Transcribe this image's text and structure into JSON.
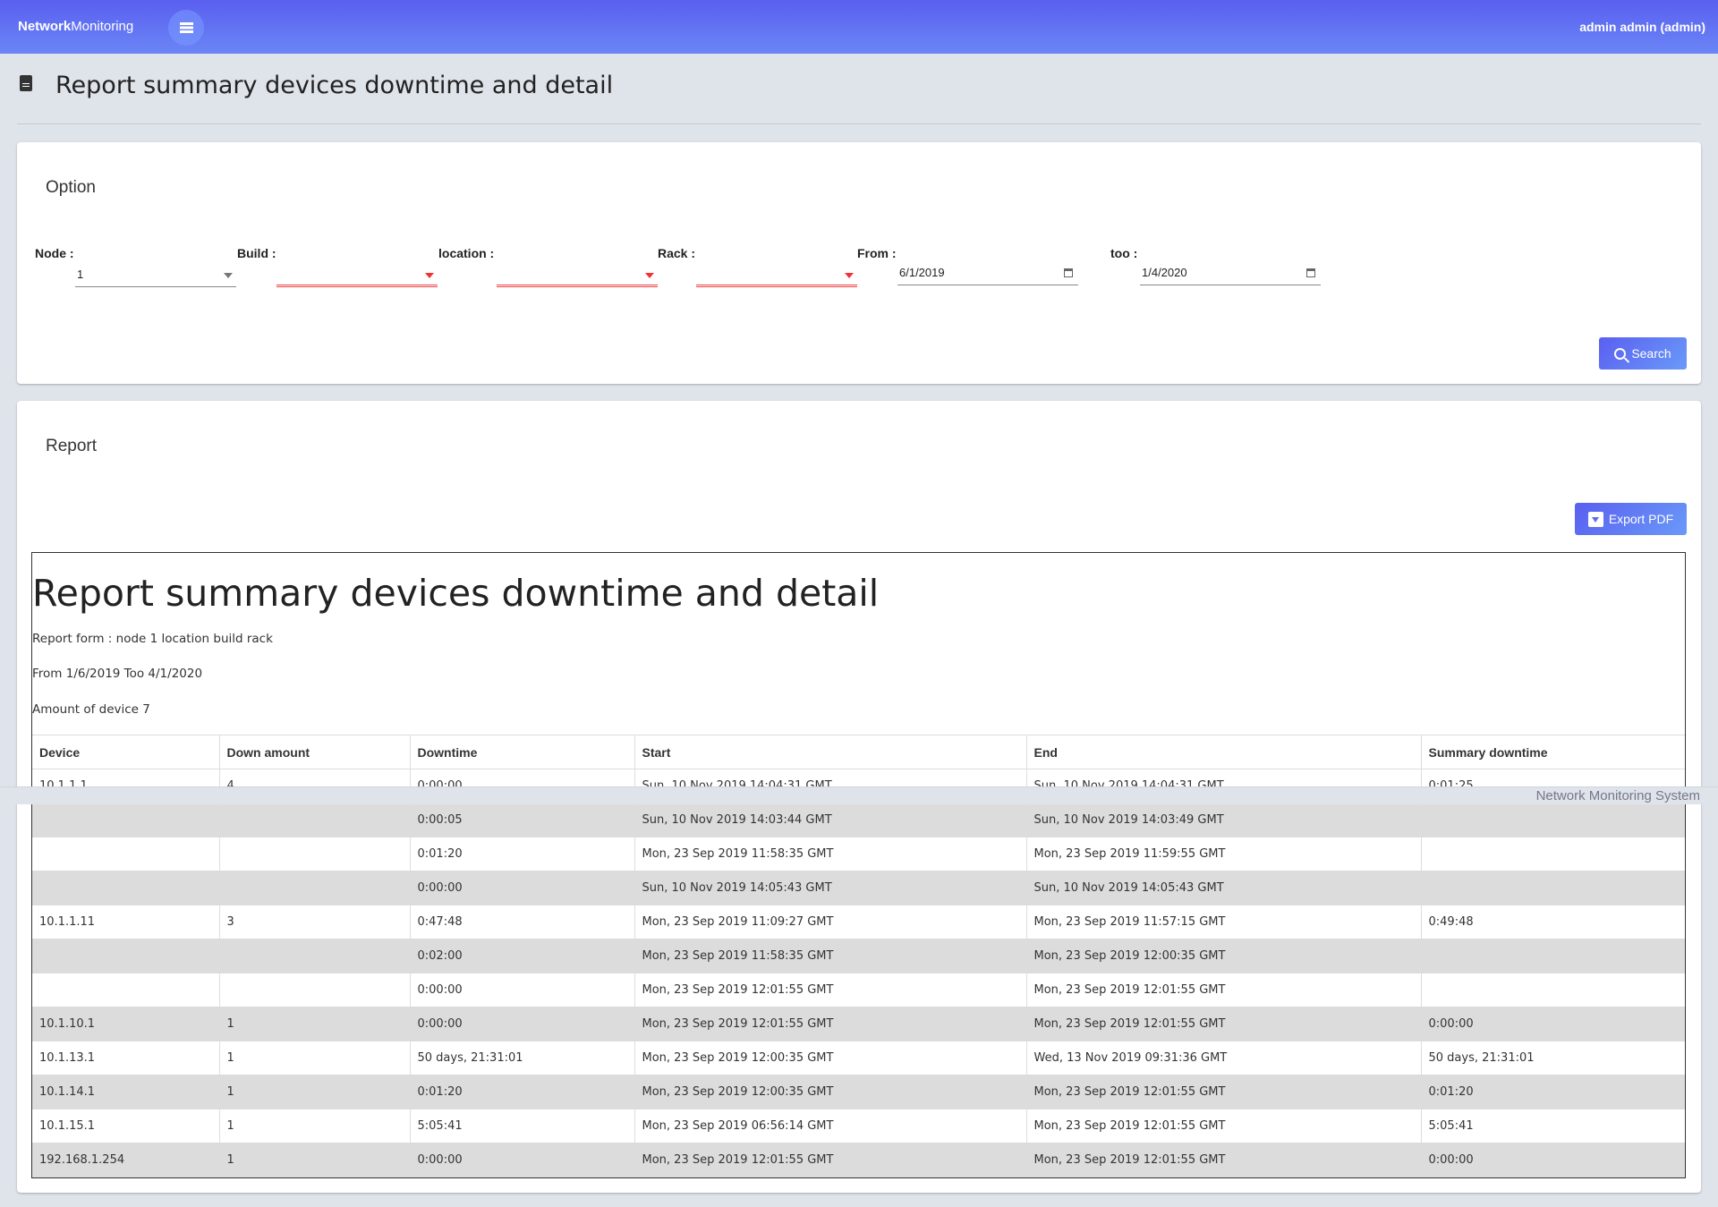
{
  "header": {
    "brand_bold": "Network",
    "brand_rest": "Monitoring",
    "user": "admin admin (admin)",
    "menu_icon": "list-icon"
  },
  "page": {
    "title": "Report summary devices downtime and detail",
    "icon": "file-icon"
  },
  "option": {
    "title": "Option",
    "node": {
      "label": "Node :",
      "value": "1"
    },
    "build": {
      "label": "Build :",
      "value": ""
    },
    "location": {
      "label": "location :",
      "value": ""
    },
    "rack": {
      "label": "Rack :",
      "value": ""
    },
    "from": {
      "label": "From :",
      "value": "6/1/2019"
    },
    "too": {
      "label": "too :",
      "value": "1/4/2020"
    },
    "search_label": "Search"
  },
  "report": {
    "title": "Report",
    "export_label": "Export PDF",
    "doc_title": "Report summary devices downtime and detail",
    "form_line": "Report form : node 1 location build rack",
    "range_line": "From 1/6/2019 Too 4/1/2020",
    "amount_line": "Amount of device 7",
    "columns": [
      "Device",
      "Down amount",
      "Downtime",
      "Start",
      "End",
      "Summary downtime"
    ],
    "rows": [
      [
        "10.1.1.1",
        "4",
        "0:00:00",
        "Sun, 10 Nov 2019 14:04:31 GMT",
        "Sun, 10 Nov 2019 14:04:31 GMT",
        "0:01:25"
      ],
      [
        "",
        "",
        "0:00:05",
        "Sun, 10 Nov 2019 14:03:44 GMT",
        "Sun, 10 Nov 2019 14:03:49 GMT",
        ""
      ],
      [
        "",
        "",
        "0:01:20",
        "Mon, 23 Sep 2019 11:58:35 GMT",
        "Mon, 23 Sep 2019 11:59:55 GMT",
        ""
      ],
      [
        "",
        "",
        "0:00:00",
        "Sun, 10 Nov 2019 14:05:43 GMT",
        "Sun, 10 Nov 2019 14:05:43 GMT",
        ""
      ],
      [
        "10.1.1.11",
        "3",
        "0:47:48",
        "Mon, 23 Sep 2019 11:09:27 GMT",
        "Mon, 23 Sep 2019 11:57:15 GMT",
        "0:49:48"
      ],
      [
        "",
        "",
        "0:02:00",
        "Mon, 23 Sep 2019 11:58:35 GMT",
        "Mon, 23 Sep 2019 12:00:35 GMT",
        ""
      ],
      [
        "",
        "",
        "0:00:00",
        "Mon, 23 Sep 2019 12:01:55 GMT",
        "Mon, 23 Sep 2019 12:01:55 GMT",
        ""
      ],
      [
        "10.1.10.1",
        "1",
        "0:00:00",
        "Mon, 23 Sep 2019 12:01:55 GMT",
        "Mon, 23 Sep 2019 12:01:55 GMT",
        "0:00:00"
      ],
      [
        "10.1.13.1",
        "1",
        "50 days, 21:31:01",
        "Mon, 23 Sep 2019 12:00:35 GMT",
        "Wed, 13 Nov 2019 09:31:36 GMT",
        "50 days, 21:31:01"
      ],
      [
        "10.1.14.1",
        "1",
        "0:01:20",
        "Mon, 23 Sep 2019 12:00:35 GMT",
        "Mon, 23 Sep 2019 12:01:55 GMT",
        "0:01:20"
      ],
      [
        "10.1.15.1",
        "1",
        "5:05:41",
        "Mon, 23 Sep 2019 06:56:14 GMT",
        "Mon, 23 Sep 2019 12:01:55 GMT",
        "5:05:41"
      ],
      [
        "192.168.1.254",
        "1",
        "0:00:00",
        "Mon, 23 Sep 2019 12:01:55 GMT",
        "Mon, 23 Sep 2019 12:01:55 GMT",
        "0:00:00"
      ]
    ]
  },
  "footer": {
    "text": "Network Monitoring System"
  },
  "colors": {
    "accent": "#5a5ff0",
    "error": "#e33333",
    "stripe": "#dcdcdc"
  }
}
